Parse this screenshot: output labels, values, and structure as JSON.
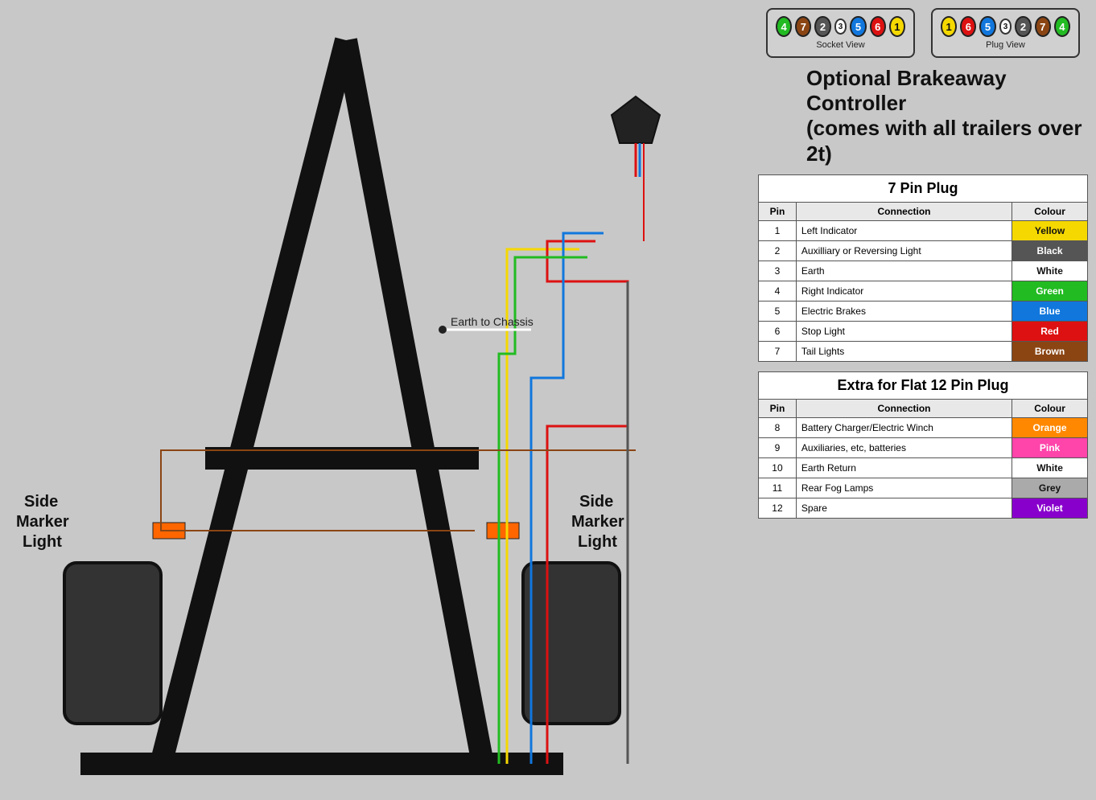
{
  "connector": {
    "socket_label": "Socket View",
    "plug_label": "Plug View",
    "socket_pins": [
      {
        "num": "4",
        "color": "#22bb22"
      },
      {
        "num": "7",
        "color": "#8B4513"
      },
      {
        "num": "2",
        "color": "#555555"
      },
      {
        "num": "3",
        "color": "#ffffff",
        "text_color": "#111"
      },
      {
        "num": "5",
        "color": "#1177dd"
      },
      {
        "num": "6",
        "color": "#dd1111"
      },
      {
        "num": "1",
        "color": "#f5d800",
        "text_color": "#111"
      }
    ],
    "plug_pins": [
      {
        "num": "1",
        "color": "#f5d800",
        "text_color": "#111"
      },
      {
        "num": "6",
        "color": "#dd1111"
      },
      {
        "num": "5",
        "color": "#1177dd"
      },
      {
        "num": "3",
        "color": "#ffffff",
        "text_color": "#111"
      },
      {
        "num": "2",
        "color": "#555555"
      },
      {
        "num": "7",
        "color": "#8B4513"
      },
      {
        "num": "4",
        "color": "#22bb22"
      }
    ]
  },
  "brakeaway": {
    "title_line1": "Optional Brakeaway Controller",
    "title_line2": "(comes with all trailers over 2t)"
  },
  "table7pin": {
    "title": "7 Pin Plug",
    "headers": [
      "Pin",
      "Connection",
      "Colour"
    ],
    "rows": [
      {
        "pin": "1",
        "connection": "Left Indicator",
        "colour": "Yellow",
        "css_class": "col-yellow"
      },
      {
        "pin": "2",
        "connection": "Auxilliary or Reversing Light",
        "colour": "Black",
        "css_class": "col-black"
      },
      {
        "pin": "3",
        "connection": "Earth",
        "colour": "White",
        "css_class": "col-white"
      },
      {
        "pin": "4",
        "connection": "Right Indicator",
        "colour": "Green",
        "css_class": "col-green"
      },
      {
        "pin": "5",
        "connection": "Electric Brakes",
        "colour": "Blue",
        "css_class": "col-blue"
      },
      {
        "pin": "6",
        "connection": "Stop Light",
        "colour": "Red",
        "css_class": "col-red"
      },
      {
        "pin": "7",
        "connection": "Tail Lights",
        "colour": "Brown",
        "css_class": "col-brown"
      }
    ]
  },
  "table12pin": {
    "title": "Extra for Flat 12 Pin Plug",
    "headers": [
      "Pin",
      "Connection",
      "Colour"
    ],
    "rows": [
      {
        "pin": "8",
        "connection": "Battery Charger/Electric Winch",
        "colour": "Orange",
        "css_class": "col-orange"
      },
      {
        "pin": "9",
        "connection": "Auxiliaries, etc, batteries",
        "colour": "Pink",
        "css_class": "col-pink"
      },
      {
        "pin": "10",
        "connection": "Earth Return",
        "colour": "White",
        "css_class": "col-white2"
      },
      {
        "pin": "11",
        "connection": "Rear Fog Lamps",
        "colour": "Grey",
        "css_class": "col-grey"
      },
      {
        "pin": "12",
        "connection": "Spare",
        "colour": "Violet",
        "css_class": "col-violet"
      }
    ]
  },
  "labels": {
    "earth_to_chassis": "Earth to Chassis",
    "side_marker_left": "Side\nMarker\nLight",
    "side_marker_right": "Side\nMarker\nLight"
  }
}
